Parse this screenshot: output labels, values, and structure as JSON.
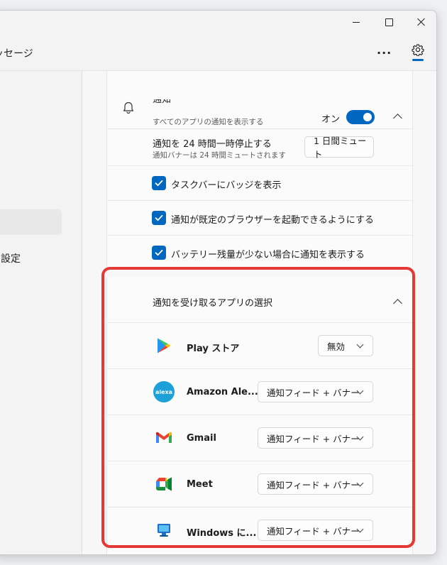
{
  "window": {
    "tab_label": "ッセージ",
    "more_label": "···",
    "colors": {
      "accent": "#0067c0",
      "highlight": "#e53935"
    }
  },
  "left_pane": {
    "item_label": "設定"
  },
  "notifications": {
    "title": "通知",
    "subtitle": "すべてのアプリの通知を表示する",
    "toggle_label": "オン",
    "toggle_on": true,
    "pause": {
      "title": "通知を 24 時間一時停止する",
      "subtitle": "通知バナーは 24 時間ミュートされます",
      "button_label": "1 日間ミュート"
    },
    "checkboxes": [
      {
        "label": "タスクバーにバッジを表示",
        "checked": true
      },
      {
        "label": "通知が既定のブラウザーを起動できるようにする",
        "checked": true
      },
      {
        "label": "バッテリー残量が少ない場合に通知を表示する",
        "checked": true
      }
    ]
  },
  "app_selection": {
    "title": "通知を受け取るアプリの選択",
    "apps": [
      {
        "name": "Play ストア",
        "icon": "play-store-icon",
        "setting": "無効"
      },
      {
        "name": "Amazon Ale...",
        "icon": "alexa-icon",
        "icon_text": "alexa",
        "setting": "通知フィード + バナー"
      },
      {
        "name": "Gmail",
        "icon": "gmail-icon",
        "setting": "通知フィード + バナー"
      },
      {
        "name": "Meet",
        "icon": "meet-icon",
        "setting": "通知フィード + バナー"
      },
      {
        "name": "Windows に...",
        "icon": "windows-link-icon",
        "setting": "通知フィード + バナー"
      }
    ]
  }
}
